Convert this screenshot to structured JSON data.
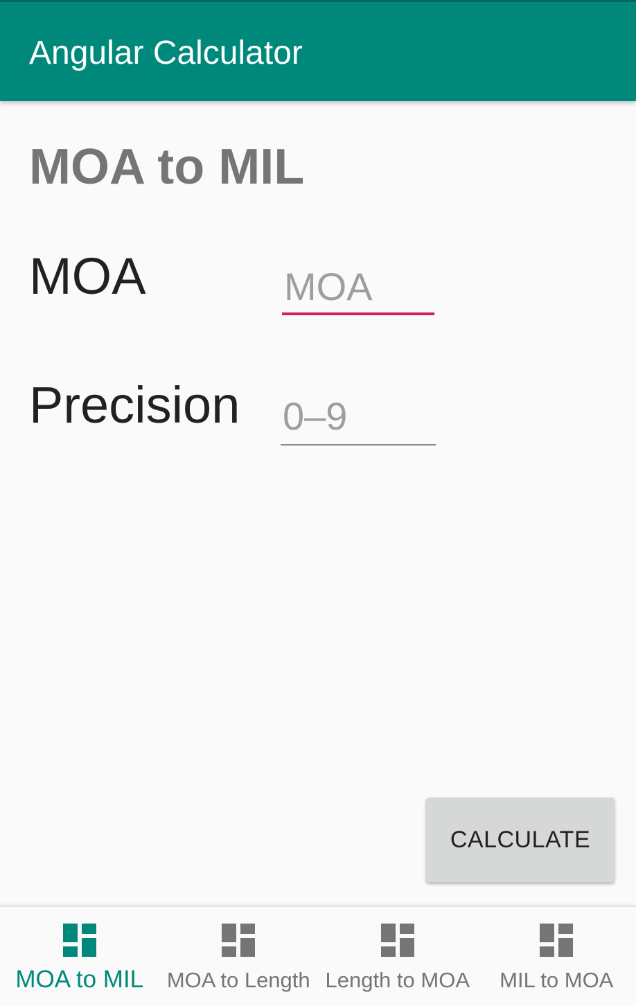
{
  "app_bar": {
    "title": "Angular Calculator"
  },
  "colors": {
    "primary": "#00897b",
    "primary_dark": "#00695c",
    "accent": "#d81b60",
    "inactive": "#757575"
  },
  "page": {
    "heading": "MOA to MIL"
  },
  "form": {
    "moa": {
      "label": "MOA",
      "value": "",
      "placeholder": "MOA"
    },
    "precision": {
      "label": "Precision",
      "value": "",
      "placeholder": "0–9"
    },
    "calculate_label": "CALCULATE"
  },
  "bottom_nav": {
    "items": [
      {
        "label": "MOA to MIL",
        "icon": "dashboard-icon",
        "active": true
      },
      {
        "label": "MOA to Length",
        "icon": "dashboard-icon",
        "active": false
      },
      {
        "label": "Length to MOA",
        "icon": "dashboard-icon",
        "active": false
      },
      {
        "label": "MIL to MOA",
        "icon": "dashboard-icon",
        "active": false
      }
    ]
  }
}
